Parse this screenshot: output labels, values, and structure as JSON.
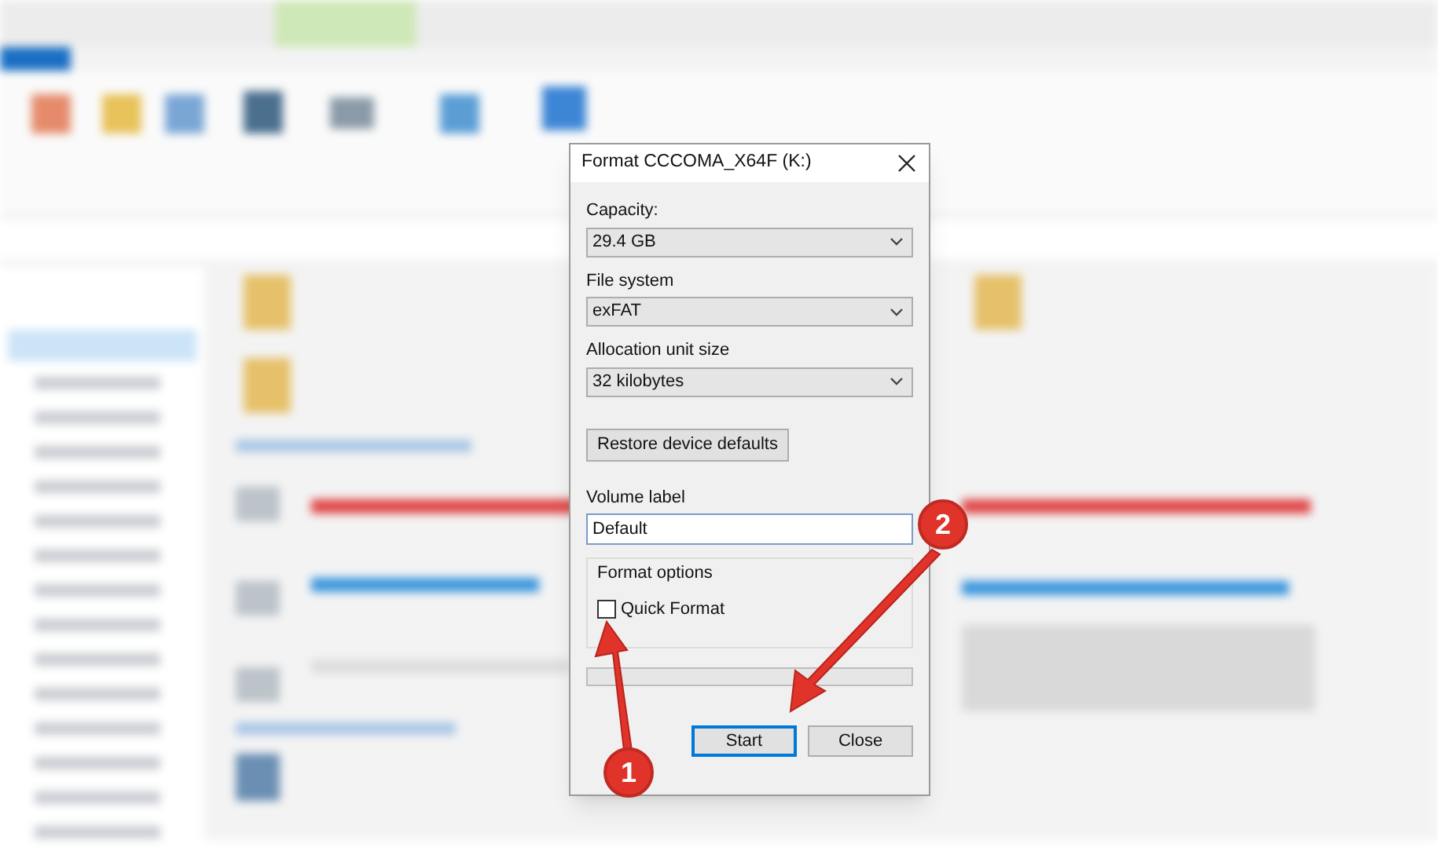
{
  "dialog": {
    "title": "Format CCCOMA_X64F (K:)",
    "fields": [
      {
        "label": "Capacity:",
        "value": "29.4 GB"
      },
      {
        "label": "File system",
        "value": "exFAT"
      },
      {
        "label": "Allocation unit size",
        "value": "32 kilobytes"
      }
    ],
    "restore_button": "Restore device defaults",
    "volume_label": {
      "label": "Volume label",
      "value": "Default"
    },
    "format_options": {
      "title": "Format options",
      "options": [
        {
          "label": "Quick Format",
          "checked": false
        }
      ]
    },
    "progress": {
      "level": 0
    },
    "buttons": [
      {
        "label": "Start",
        "selected": true
      },
      {
        "label": "Close",
        "selected": false
      }
    ]
  },
  "annotations": [
    {
      "number": "1"
    },
    {
      "number": "2"
    }
  ]
}
